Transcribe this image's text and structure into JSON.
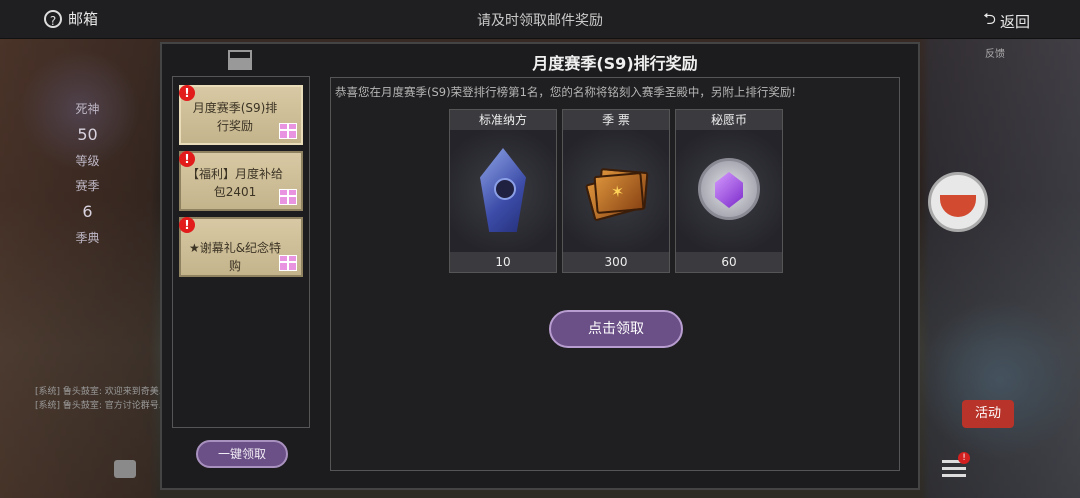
{
  "topbar": {
    "mailbox_label": "邮箱",
    "hint": "请及时领取邮件奖励",
    "back_label": "返回"
  },
  "background": {
    "left_side": {
      "label1": "死神",
      "level_num": "50",
      "label2": "等级",
      "label3": "赛季",
      "season_num": "6",
      "label4": "季典"
    },
    "chat_lines": [
      "[系统] 鲁头鼓室: 欢迎来到奇美...",
      "[系统] 鲁头鼓室: 官方讨论群号..."
    ],
    "activity_label": "活动",
    "feedback_label": "反馈",
    "menu_badge": "!"
  },
  "mail_list": {
    "items": [
      {
        "title": "月度赛季(S9)排行奖励",
        "badge": "!"
      },
      {
        "title": "【福利】月度补给包2401",
        "badge": "!"
      },
      {
        "title": "★谢幕礼&纪念特购",
        "badge": "!"
      }
    ],
    "claim_all_label": "一键领取"
  },
  "mail_detail": {
    "title": "月度赛季(S9)排行奖励",
    "body": "恭喜您在月度赛季(S9)荣登排行榜第1名，您的名称将铭刻入赛季圣殿中，另附上排行奖励!",
    "rewards": [
      {
        "name": "标准纳方",
        "qty": "10",
        "icon": "blue-crystal-icon"
      },
      {
        "name": "季 票",
        "qty": "300",
        "icon": "season-ticket-icon"
      },
      {
        "name": "秘愿币",
        "qty": "60",
        "icon": "wish-coin-icon"
      }
    ],
    "claim_label": "点击领取"
  },
  "colors": {
    "button_purple": "#6b4f87",
    "badge_red": "#e21b1b",
    "mail_item_bg": "#d8c9a4"
  }
}
